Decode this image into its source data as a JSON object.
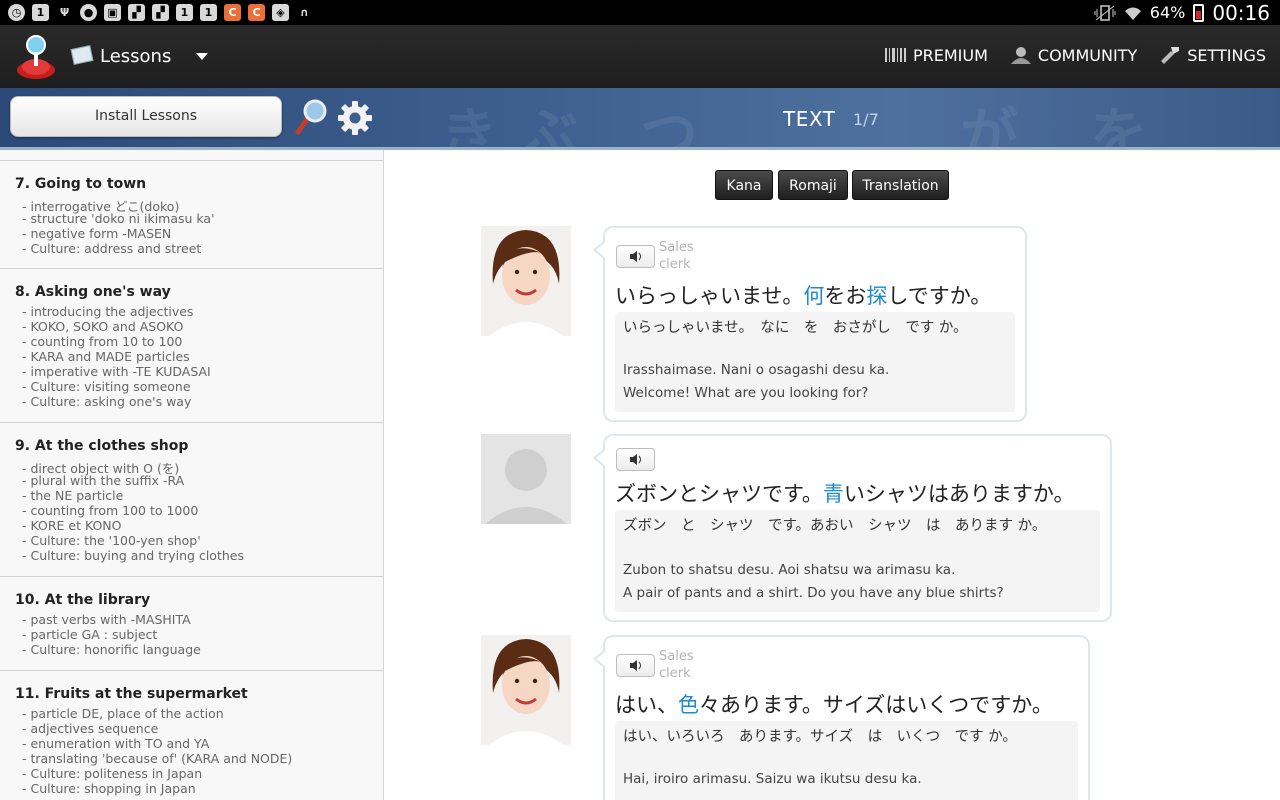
{
  "status_bar": {
    "battery": "64%",
    "time": "00:16",
    "left_icons": [
      "alarm-icon",
      "calendar-icon",
      "usb-icon",
      "circle-icon",
      "image-icon",
      "flag-icon",
      "flag-icon",
      "calendar-icon",
      "calendar-icon",
      "c-icon",
      "c-icon",
      "bag-icon",
      "headset-icon"
    ]
  },
  "action_bar": {
    "title": "Lessons",
    "menu": [
      {
        "label": "PREMIUM",
        "icon": "barcode-icon"
      },
      {
        "label": "COMMUNITY",
        "icon": "people-icon"
      },
      {
        "label": "SETTINGS",
        "icon": "wrench-icon"
      }
    ]
  },
  "banner": {
    "install_label": "Install Lessons",
    "title": "TEXT",
    "page": "1/7"
  },
  "sidebar": {
    "lessons": [
      {
        "name": "7. Going to town",
        "lines": [
          "- interrogative どこ(doko)",
          "- structure 'doko ni ikimasu ka'",
          "- negative form -MASEN",
          "- Culture: address and street"
        ]
      },
      {
        "name": "8. Asking one's way",
        "lines": [
          "- introducing the adjectives",
          "- KOKO, SOKO and ASOKO",
          "- counting from 10 to 100",
          "- KARA and MADE particles",
          "- imperative with -TE KUDASAI",
          "- Culture: visiting someone",
          "- Culture: asking one's way"
        ]
      },
      {
        "name": "9. At the clothes shop",
        "lines": [
          "- direct object with O (を)",
          "- plural with the suffix -RA",
          "- the NE particle",
          "- counting from 100 to 1000",
          "- KORE et KONO",
          "- Culture: the '100-yen shop'",
          "- Culture: buying and trying clothes"
        ]
      },
      {
        "name": "10. At the library",
        "lines": [
          "- past verbs with -MASHITA",
          "- particle GA : subject",
          "- Culture: honorific language"
        ]
      },
      {
        "name": "11. Fruits at the supermarket",
        "lines": [
          "- particle DE, place of the action",
          "- adjectives sequence",
          "- enumeration with TO and YA",
          "- translating 'because of' (KARA and NODE)",
          "- Culture: politeness in Japan",
          "- Culture: shopping in Japan"
        ]
      }
    ]
  },
  "toggles": [
    "Kana",
    "Romaji",
    "Translation"
  ],
  "dialogue": [
    {
      "role": "Sales clerk",
      "parts": [
        {
          "text": "いらっしゃいませ。",
          "hl": false
        },
        {
          "text": "何",
          "hl": true
        },
        {
          "text": "をお",
          "hl": false
        },
        {
          "text": "探",
          "hl": true
        },
        {
          "text": "しですか。",
          "hl": false
        }
      ],
      "kana": "いらっしゃいませ。　なに　を　おさがし　です か。",
      "romaji": "Irasshaimase. Nani o osagashi desu ka.",
      "translation": "Welcome! What are you looking for?"
    },
    {
      "role": "",
      "parts": [
        {
          "text": "ズボンとシャツです。",
          "hl": false
        },
        {
          "text": "青",
          "hl": true
        },
        {
          "text": "いシャツはありますか。",
          "hl": false
        }
      ],
      "kana": "ズボン　と　シャツ　です。あおい　シャツ　は　あります か。",
      "romaji": "Zubon to shatsu desu. Aoi shatsu wa arimasu ka.",
      "translation": "A pair of pants and a shirt. Do you have any blue shirts?"
    },
    {
      "role": "Sales clerk",
      "parts": [
        {
          "text": "はい、",
          "hl": false
        },
        {
          "text": "色",
          "hl": true
        },
        {
          "text": "々あります。サイズはいくつですか。",
          "hl": false
        }
      ],
      "kana": "はい、いろいろ　あります。サイズ　は　いくつ　です か。",
      "romaji": "Hai, iroiro arimasu. Saizu wa ikutsu desu ka.",
      "translation": ""
    }
  ],
  "colors": {
    "highlight": "#1e8ad0",
    "banner": "#3d5f8f"
  }
}
